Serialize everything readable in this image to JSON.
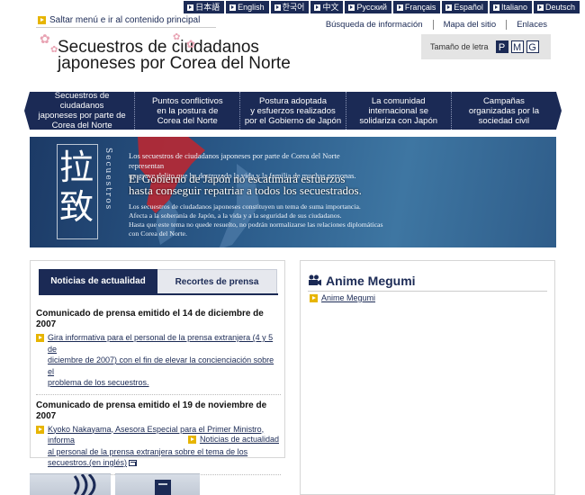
{
  "languages": [
    "日本語",
    "English",
    "한국어",
    "中文",
    "Русский",
    "Français",
    "Español",
    "Italiano",
    "Deutsch"
  ],
  "skip_link": "Saltar menú e ir al contenido principal",
  "utility_links": [
    "Búsqueda de información",
    "Mapa del sitio",
    "Enlaces"
  ],
  "site_title": {
    "line1": "Secuestros de ciudadanos",
    "line2": "japoneses por Corea del Norte"
  },
  "font_size": {
    "label": "Tamaño de letra",
    "options": [
      "P",
      "M",
      "G"
    ],
    "selected": "P"
  },
  "nav": [
    {
      "line1": "Secuestros de ciudadanos",
      "line2": "japoneses por parte de",
      "line3": "Corea del Norte"
    },
    {
      "line1": "Puntos conflictivos",
      "line2": "en la postura de",
      "line3": "Corea del Norte"
    },
    {
      "line1": "Postura adoptada",
      "line2": "y esfuerzos realizados",
      "line3": "por el Gobierno de Japón"
    },
    {
      "line1": "La comunidad",
      "line2": "internacional se",
      "line3": "solidariza con Japón"
    },
    {
      "line1": "Campañas",
      "line2": "organizadas por la",
      "line3": "sociedad civil"
    }
  ],
  "banner": {
    "kanji1": "拉",
    "kanji2": "致",
    "vertical": "Secuestros",
    "text1a": "Los secuestros de ciudadanos japoneses por parte de Corea del Norte representan",
    "text1b": "un grave delito que ha destrozado la vida y la familia de muchas personas.",
    "text2a": "El Gobierno de Japón no escatimará esfuerzos",
    "text2b": "hasta conseguir repatriar a todos los secuestrados.",
    "text3a": "Los secuestros de ciudadanos japoneses constituyen un tema de suma importancia.",
    "text3b": "Afecta a la soberanía de Japón, a la vida y a la seguridad de sus ciudadanos.",
    "text3c": "Hasta que este tema no quede resuelto, no podrán normalizarse las relaciones diplomáticas",
    "text3d": "con Corea del Norte."
  },
  "news": {
    "tabs": [
      "Noticias de actualidad",
      "Recortes de prensa"
    ],
    "active_tab": 0,
    "items": [
      {
        "title": "Comunicado de prensa emitido el 14 de diciembre de 2007",
        "link_lines": [
          "Gira informativa para el personal de la prensa extranjera (4 y 5 de",
          "diciembre de 2007) con el fin de elevar la concienciación sobre el",
          "problema de los secuestros."
        ]
      },
      {
        "title": "Comunicado de prensa emitido el 19 de noviembre de 2007",
        "link_lines": [
          "Kyoko Nakayama, Asesora Especial para el Primer Ministro, informa",
          "al personal de la prensa extranjera sobre el tema de los",
          "secuestros.(en inglés)"
        ]
      }
    ],
    "more_link": "Noticias de actualidad"
  },
  "anime": {
    "heading": "Anime Megumi",
    "link": "Anime Megumi"
  },
  "colors": {
    "navy": "#1b2a55",
    "accent_yellow": "#e7b500",
    "blossom": "#e8a3b3"
  }
}
